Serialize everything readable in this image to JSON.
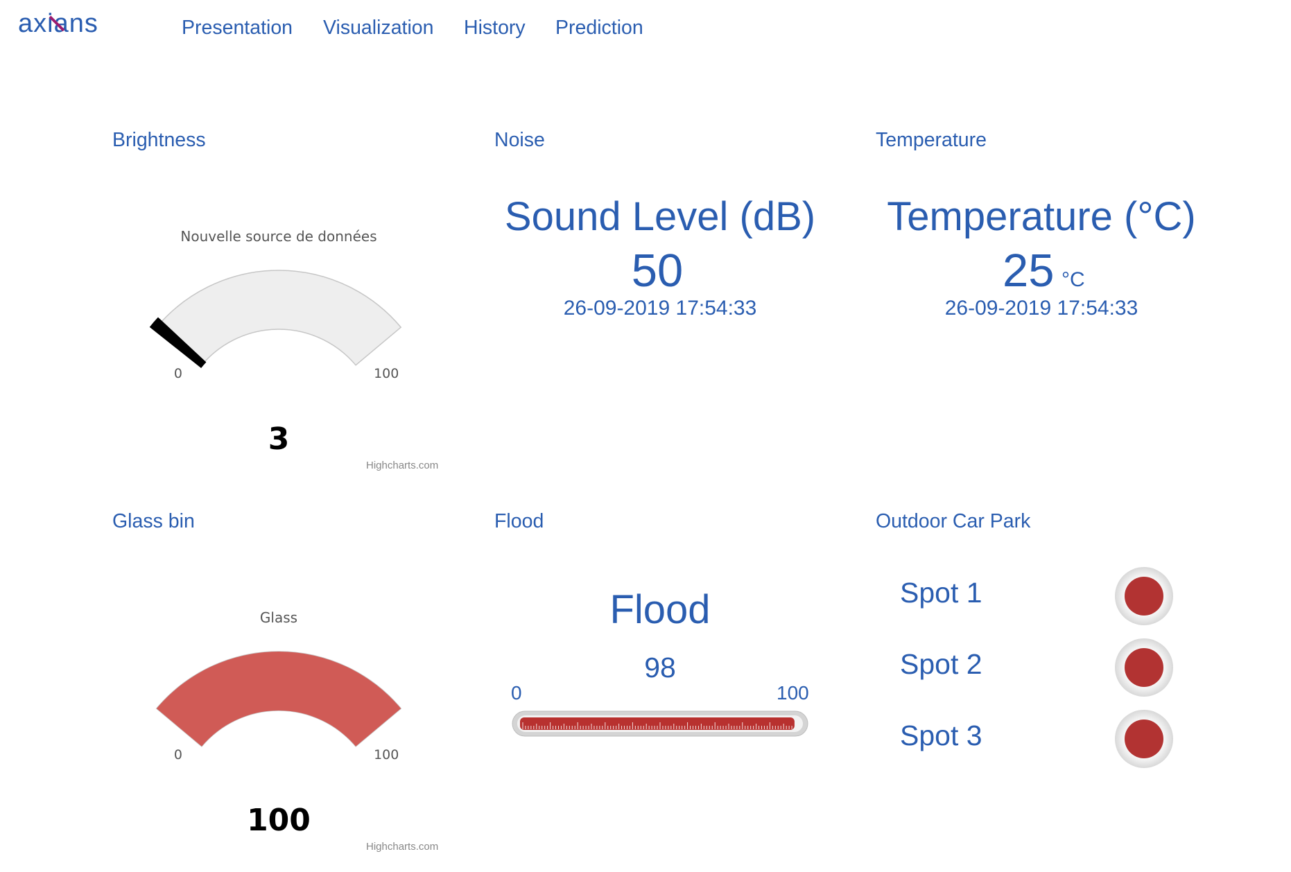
{
  "brand": {
    "logo_text": "axians"
  },
  "nav": {
    "items": [
      {
        "label": "Presentation"
      },
      {
        "label": "Visualization"
      },
      {
        "label": "History"
      },
      {
        "label": "Prediction"
      }
    ]
  },
  "colors": {
    "accent": "#2a5db0",
    "gauge_fill_red": "#d05b56",
    "gauge_background": "#eeeeee",
    "thermometer_red": "#b8312f",
    "spot_red": "#b23332"
  },
  "brightness": {
    "title": "Brightness",
    "gauge_label": "Nouvelle source de données",
    "min_label": "0",
    "max_label": "100",
    "value": "3",
    "value_num": 3,
    "min_num": 0,
    "max_num": 100,
    "credit": "Highcharts.com"
  },
  "noise": {
    "title": "Noise",
    "heading": "Sound Level (dB)",
    "value": "50",
    "timestamp": "26-09-2019 17:54:33"
  },
  "temperature": {
    "title": "Temperature",
    "heading": "Temperature (°C)",
    "value": "25",
    "unit": "°C",
    "timestamp": "26-09-2019 17:54:33"
  },
  "glass_bin": {
    "title": "Glass bin",
    "gauge_label": "Glass",
    "min_label": "0",
    "max_label": "100",
    "value": "100",
    "value_num": 100,
    "min_num": 0,
    "max_num": 100,
    "credit": "Highcharts.com"
  },
  "flood": {
    "title": "Flood",
    "heading": "Flood",
    "value": "98",
    "value_num": 98,
    "min_label": "0",
    "max_label": "100",
    "min_num": 0,
    "max_num": 100
  },
  "car_park": {
    "title": "Outdoor Car Park",
    "spots": [
      {
        "label": "Spot 1",
        "status": "occupied"
      },
      {
        "label": "Spot 2",
        "status": "occupied"
      },
      {
        "label": "Spot 3",
        "status": "occupied"
      }
    ]
  }
}
